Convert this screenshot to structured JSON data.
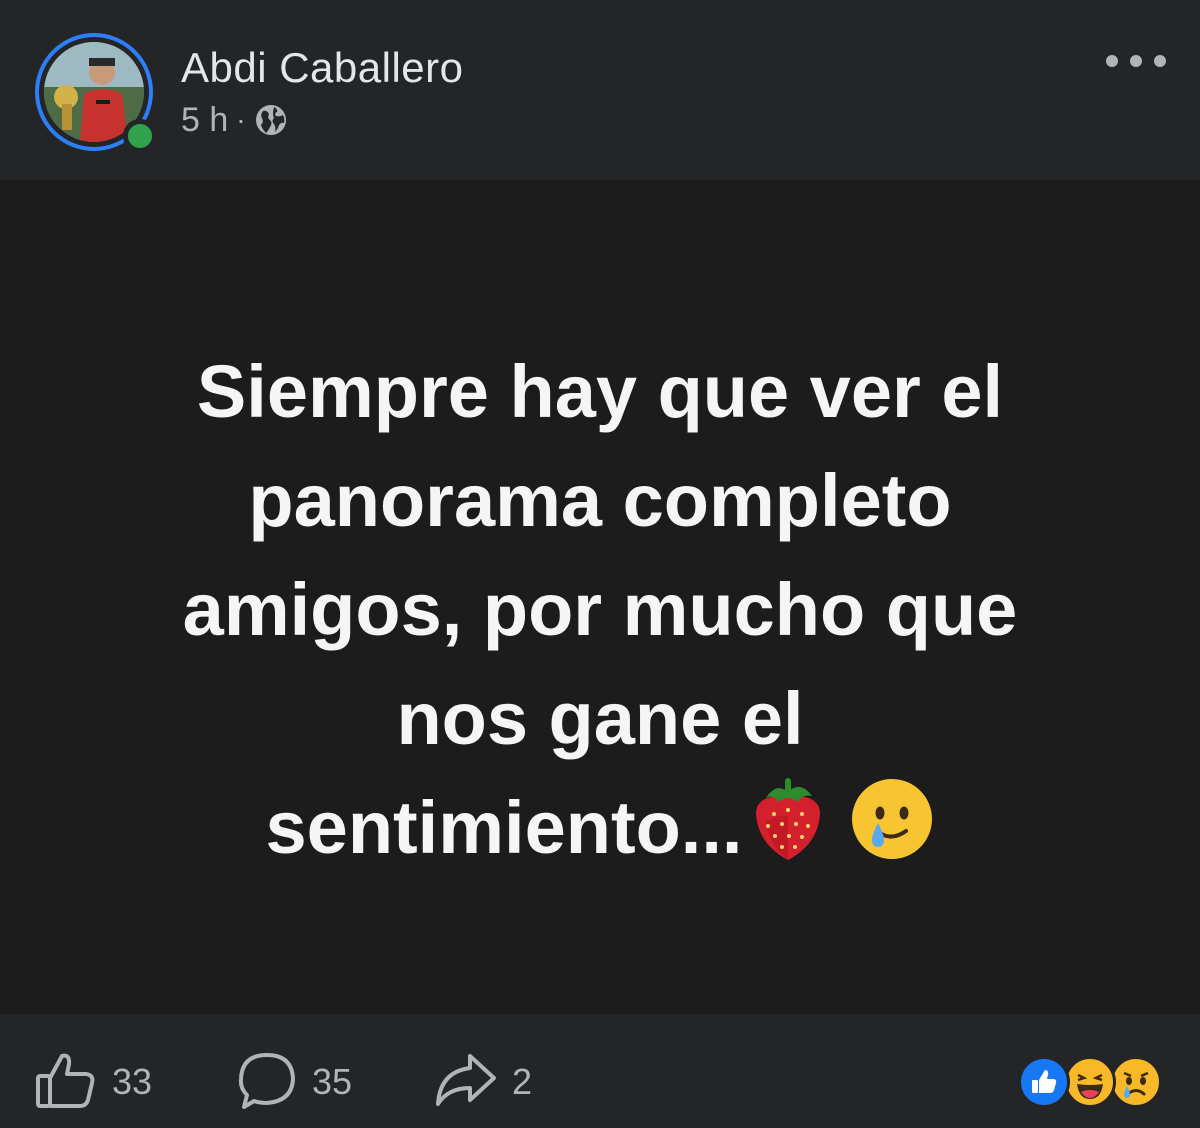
{
  "post": {
    "author": "Abdi Caballero",
    "time": "5 h",
    "separator": "·",
    "privacy_icon": "globe-icon",
    "text_lines": [
      "Siempre hay que ver el",
      "panorama completo",
      "amigos, por mucho que",
      "nos gane el",
      "sentimiento..."
    ],
    "text_emojis": [
      "strawberry-emoji",
      "smiling-face-with-tear-emoji"
    ],
    "background_color": "#1c1c1d"
  },
  "footer": {
    "likes": "33",
    "comments": "35",
    "shares": "2",
    "reactions": [
      "like-reaction",
      "laugh-reaction",
      "sad-reaction"
    ]
  },
  "colors": {
    "accent": "#2d7ff9",
    "online": "#31a24c",
    "like_blue": "#1877f2",
    "reaction_yellow": "#f7b928"
  }
}
